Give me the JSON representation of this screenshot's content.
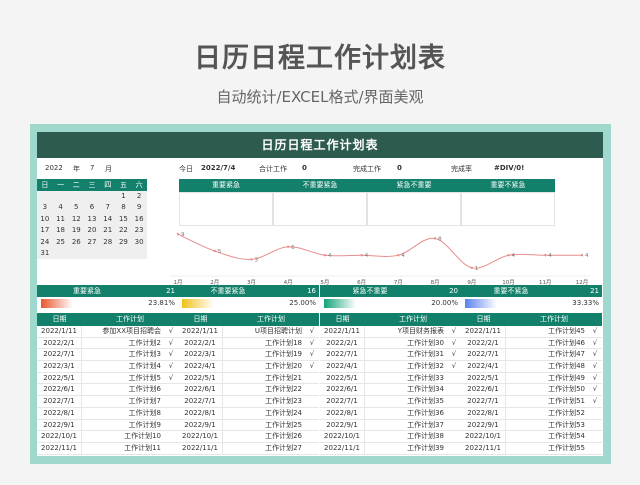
{
  "page": {
    "title": "日历日程工作计划表",
    "subtitle": "自动统计/EXCEL格式/界面美观"
  },
  "sheet": {
    "title": "日历日程工作计划表",
    "year": "2022",
    "year_unit": "年",
    "month": "7",
    "month_unit": "月",
    "today_label": "今日",
    "today_value": "2022/7/4",
    "total_label": "合计工作",
    "total_value": "0",
    "done_label": "完成工作",
    "done_value": "0",
    "rate_label": "完成率",
    "rate_value": "#DIV/0!"
  },
  "calendar": {
    "weekdays": [
      "日",
      "一",
      "二",
      "三",
      "四",
      "五",
      "六"
    ],
    "days": [
      "",
      "",
      "",
      "",
      "",
      "1",
      "2",
      "3",
      "4",
      "5",
      "6",
      "7",
      "8",
      "9",
      "10",
      "11",
      "12",
      "13",
      "14",
      "15",
      "16",
      "17",
      "18",
      "19",
      "20",
      "21",
      "22",
      "23",
      "24",
      "25",
      "26",
      "27",
      "28",
      "29",
      "30",
      "31"
    ]
  },
  "categories": [
    "重要紧急",
    "不重要紧急",
    "紧急不重要",
    "重要不紧急"
  ],
  "chart_data": {
    "type": "line",
    "categories": [
      "1月",
      "2月",
      "3月",
      "4月",
      "5月",
      "6月",
      "7月",
      "8月",
      "9月",
      "10月",
      "11月",
      "12月"
    ],
    "series": [
      {
        "values": [
          9,
          5,
          3,
          6,
          4,
          4,
          4,
          8,
          1,
          4,
          4,
          4
        ]
      }
    ],
    "ylim": [
      0,
      10
    ],
    "grid": false,
    "color": "#e98d8d"
  },
  "stats": [
    {
      "label": "重要紧急",
      "count": "21",
      "percent": "23.81%",
      "gradient": [
        "#e8552e",
        "#ffffff"
      ],
      "fraction": 0.2381
    },
    {
      "label": "不重要紧急",
      "count": "16",
      "percent": "25.00%",
      "gradient": [
        "#f0c21b",
        "#ffffff"
      ],
      "fraction": 0.25
    },
    {
      "label": "紧急不重要",
      "count": "20",
      "percent": "20.00%",
      "gradient": [
        "#12a37a",
        "#ffffff"
      ],
      "fraction": 0.2
    },
    {
      "label": "重要不紧急",
      "count": "21",
      "percent": "33.33%",
      "gradient": [
        "#5a82f0",
        "#ffffff"
      ],
      "fraction": 0.3333
    }
  ],
  "table_headers": {
    "date": "日期",
    "task": "工作计划"
  },
  "tables": [
    {
      "rows": [
        {
          "date": "2022/1/11",
          "task": "参加XX项目招聘会",
          "check": "√"
        },
        {
          "date": "2022/2/1",
          "task": "工作计划2",
          "check": "√"
        },
        {
          "date": "2022/7/1",
          "task": "工作计划3",
          "check": "√"
        },
        {
          "date": "2022/3/1",
          "task": "工作计划4",
          "check": "√"
        },
        {
          "date": "2022/5/1",
          "task": "工作计划5",
          "check": "√"
        },
        {
          "date": "2022/6/1",
          "task": "工作计划6",
          "check": ""
        },
        {
          "date": "2022/7/1",
          "task": "工作计划7",
          "check": ""
        },
        {
          "date": "2022/8/1",
          "task": "工作计划8",
          "check": ""
        },
        {
          "date": "2022/9/1",
          "task": "工作计划9",
          "check": ""
        },
        {
          "date": "2022/10/1",
          "task": "工作计划10",
          "check": ""
        },
        {
          "date": "2022/11/1",
          "task": "工作计划11",
          "check": ""
        }
      ]
    },
    {
      "rows": [
        {
          "date": "2022/1/11",
          "task": "U项目招聘计划",
          "check": "√"
        },
        {
          "date": "2022/2/1",
          "task": "工作计划18",
          "check": "√"
        },
        {
          "date": "2022/3/1",
          "task": "工作计划19",
          "check": "√"
        },
        {
          "date": "2022/4/1",
          "task": "工作计划20",
          "check": "√"
        },
        {
          "date": "2022/5/1",
          "task": "工作计划21",
          "check": ""
        },
        {
          "date": "2022/6/1",
          "task": "工作计划22",
          "check": ""
        },
        {
          "date": "2022/7/1",
          "task": "工作计划23",
          "check": ""
        },
        {
          "date": "2022/8/1",
          "task": "工作计划24",
          "check": ""
        },
        {
          "date": "2022/9/1",
          "task": "工作计划25",
          "check": ""
        },
        {
          "date": "2022/10/1",
          "task": "工作计划26",
          "check": ""
        },
        {
          "date": "2022/11/1",
          "task": "工作计划27",
          "check": ""
        }
      ]
    },
    {
      "rows": [
        {
          "date": "2022/1/11",
          "task": "Y项目财务报表",
          "check": "√"
        },
        {
          "date": "2022/2/1",
          "task": "工作计划30",
          "check": "√"
        },
        {
          "date": "2022/7/1",
          "task": "工作计划31",
          "check": "√"
        },
        {
          "date": "2022/4/1",
          "task": "工作计划32",
          "check": "√"
        },
        {
          "date": "2022/5/1",
          "task": "工作计划33",
          "check": ""
        },
        {
          "date": "2022/6/1",
          "task": "工作计划34",
          "check": ""
        },
        {
          "date": "2022/7/1",
          "task": "工作计划35",
          "check": ""
        },
        {
          "date": "2022/8/1",
          "task": "工作计划36",
          "check": ""
        },
        {
          "date": "2022/9/1",
          "task": "工作计划37",
          "check": ""
        },
        {
          "date": "2022/10/1",
          "task": "工作计划38",
          "check": ""
        },
        {
          "date": "2022/11/1",
          "task": "工作计划39",
          "check": ""
        }
      ]
    },
    {
      "rows": [
        {
          "date": "2022/1/11",
          "task": "工作计划45",
          "check": "√"
        },
        {
          "date": "2022/2/1",
          "task": "工作计划46",
          "check": "√"
        },
        {
          "date": "2022/7/1",
          "task": "工作计划47",
          "check": "√"
        },
        {
          "date": "2022/4/1",
          "task": "工作计划48",
          "check": "√"
        },
        {
          "date": "2022/5/1",
          "task": "工作计划49",
          "check": "√"
        },
        {
          "date": "2022/6/1",
          "task": "工作计划50",
          "check": "√"
        },
        {
          "date": "2022/7/1",
          "task": "工作计划51",
          "check": "√"
        },
        {
          "date": "2022/8/1",
          "task": "工作计划52",
          "check": ""
        },
        {
          "date": "2022/9/1",
          "task": "工作计划53",
          "check": ""
        },
        {
          "date": "2022/10/1",
          "task": "工作计划54",
          "check": ""
        },
        {
          "date": "2022/11/1",
          "task": "工作计划55",
          "check": ""
        }
      ]
    }
  ]
}
